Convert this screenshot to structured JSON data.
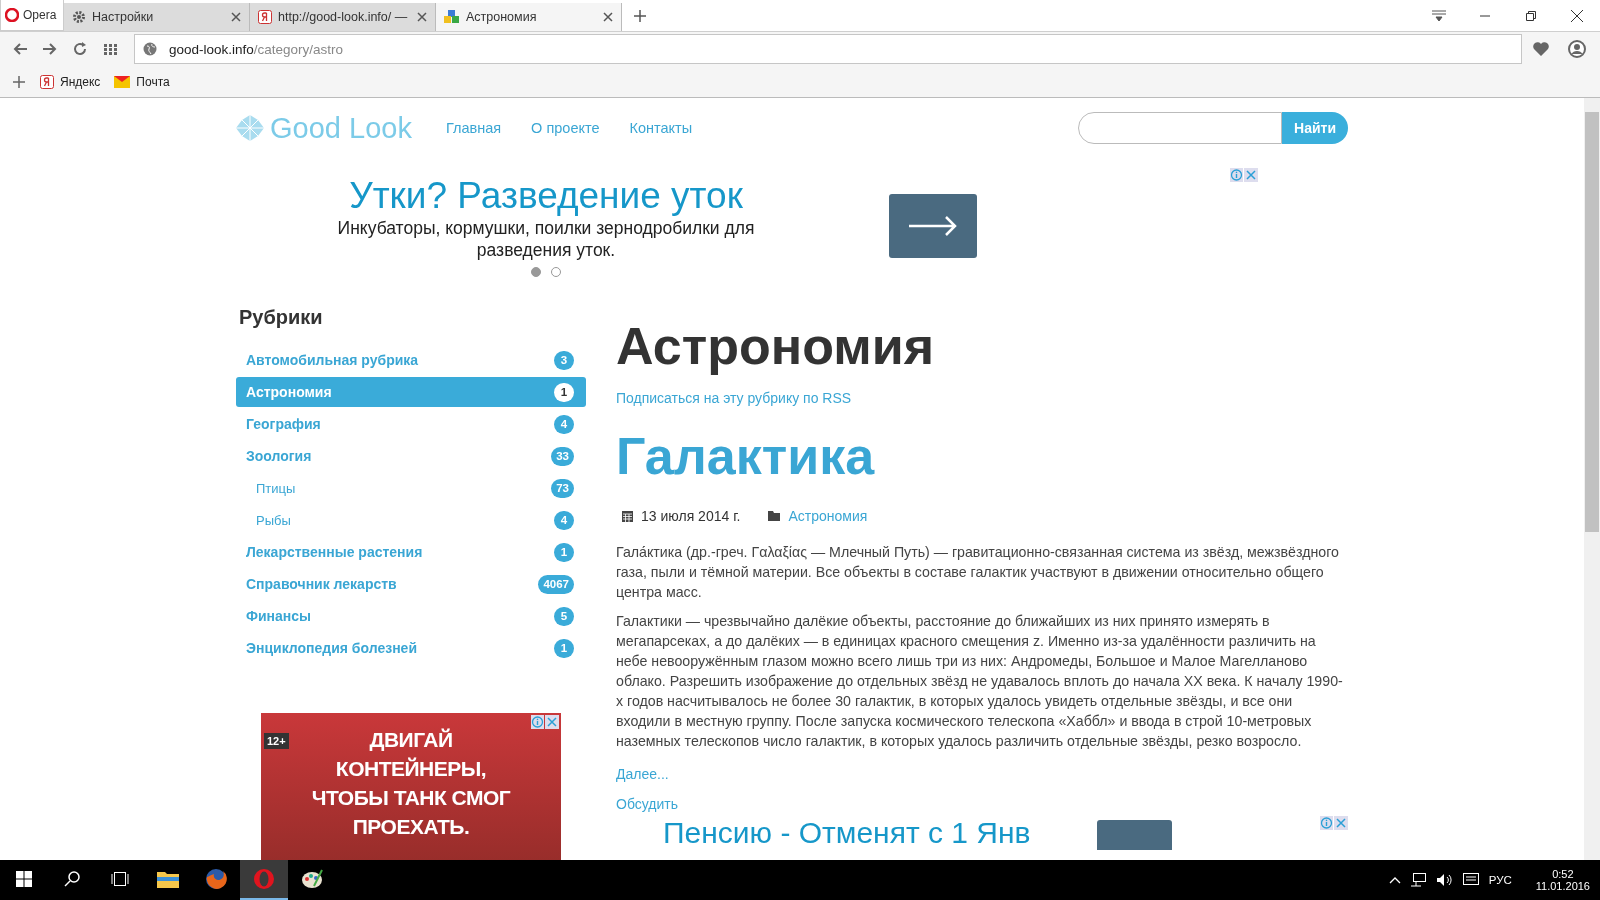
{
  "browser": {
    "menu_label": "Opera",
    "tabs": [
      {
        "title": "Настройки",
        "selected": false
      },
      {
        "title": "http://good-look.info/ — ",
        "selected": false
      },
      {
        "title": "Астрономия",
        "selected": true
      }
    ],
    "address": {
      "host": "good-look.info",
      "path": "/category/astro"
    },
    "bookmarks": [
      {
        "label": "Яндекс"
      },
      {
        "label": "Почта"
      }
    ]
  },
  "site": {
    "logo": "Good Look",
    "nav": [
      "Главная",
      "О проекте",
      "Контакты"
    ],
    "search": {
      "button": "Найти"
    }
  },
  "top_ad": {
    "title": "Утки? Разведение уток",
    "text": "Инкубаторы, кормушки, поилки зернодробилки для разведения уток.",
    "slides": [
      {
        "selected": true
      },
      {
        "selected": false
      }
    ]
  },
  "sidebar": {
    "heading": "Рубрики",
    "items": [
      {
        "label": "Автомобильная рубрика",
        "count": "3",
        "selected": false
      },
      {
        "label": "Астрономия",
        "count": "1",
        "selected": true
      },
      {
        "label": "География",
        "count": "4",
        "selected": false
      },
      {
        "label": "Зоология",
        "count": "33",
        "selected": false,
        "children": [
          {
            "label": "Птицы",
            "count": "73",
            "selected": false
          },
          {
            "label": "Рыбы",
            "count": "4",
            "selected": false
          }
        ]
      },
      {
        "label": "Лекарственные растения",
        "count": "1",
        "selected": false
      },
      {
        "label": "Справочник лекарств",
        "count": "4067",
        "selected": false
      },
      {
        "label": "Финансы",
        "count": "5",
        "selected": false
      },
      {
        "label": "Энциклопедия болезней",
        "count": "1",
        "selected": false
      }
    ],
    "ad": {
      "age": "12+",
      "text": "ДВИГАЙ КОНТЕЙНЕРЫ, ЧТОБЫ ТАНК СМОГ ПРОЕХАТЬ."
    }
  },
  "main": {
    "title": "Астрономия",
    "rss": "Подписаться на эту рубрику по RSS",
    "post": {
      "title": "Галактика",
      "date": "13 июля 2014 г.",
      "category": "Астрономия",
      "paragraphs": [
        "Гала́ктика (др.-греч. Γαλαξίας — Млечный Путь) — гравитационно-связанная система из звёзд, межзвёздного газа, пыли и тёмной материи. Все объекты в составе галактик участвуют в движении относительно общего центра масс.",
        "Галактики — чрезвычайно далёкие объекты, расстояние до ближайших из них принято измерять в мегапарсеках, а до далёких — в единицах красного смещения z. Именно из-за удалённости различить на небе невооружённым глазом можно всего лишь три из них: Андромеды, Большое и Малое Магелланово облако. Разрешить изображение до отдельных звёзд не удавалось вплоть до начала XX века. К началу 1990-х годов насчитывалось не более 30 галактик, в которых удалось увидеть отдельные звёзды, и все они входили в местную группу. После запуска космического телескопа «Хаббл» и ввода в строй 10-метровых наземных телескопов число галактик, в которых удалось различить отдельные звёзды, резко возросло."
      ],
      "more": "Далее...",
      "discuss": "Обсудить"
    },
    "bottom_ad": {
      "title": "Пенсию - Отменят с 1 Янв"
    }
  },
  "taskbar": {
    "apps": [
      {
        "selected": false
      },
      {
        "selected": false
      },
      {
        "selected": true
      },
      {
        "selected": false
      }
    ],
    "language": "РУС",
    "time": "0:52",
    "date": "11.01.2016"
  }
}
